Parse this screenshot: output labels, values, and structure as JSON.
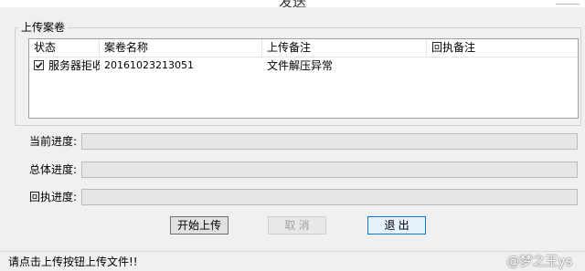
{
  "window": {
    "title": "发送"
  },
  "upload_group": {
    "legend": "上传案卷",
    "columns": [
      "状态",
      "案卷名称",
      "上传备注",
      "回执备注"
    ],
    "rows": [
      {
        "checked": true,
        "status": "服务器拒收",
        "name": "20161023213051",
        "upload_note": "文件解压异常",
        "receipt_note": ""
      }
    ]
  },
  "progress": {
    "current": {
      "label": "当前进度:",
      "value_percent": 0
    },
    "total": {
      "label": "总体进度:",
      "value_percent": 0
    },
    "receipt": {
      "label": "回执进度:",
      "value_percent": 0
    }
  },
  "buttons": {
    "start": "开始上传",
    "cancel": "取 消",
    "exit": "退 出"
  },
  "status_bar": {
    "text": "请点击上传按钮上传文件!!"
  },
  "watermark": {
    "text": "@梦之王ys"
  },
  "colors": {
    "progress_fill": "#06b025",
    "default_button_border": "#0078d7"
  }
}
